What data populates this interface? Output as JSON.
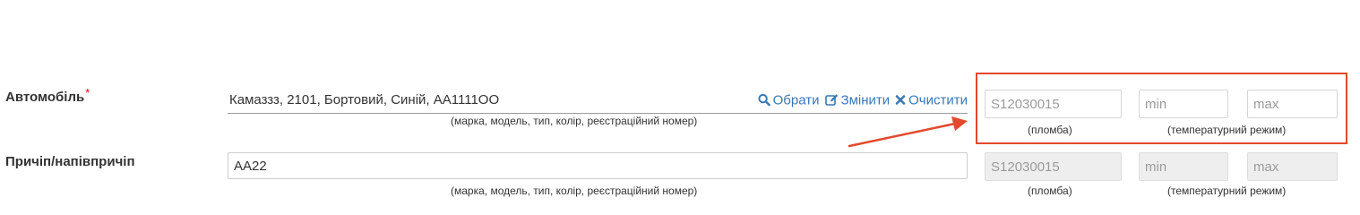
{
  "rows": [
    {
      "label": "Автомобіль",
      "required_mark": "*",
      "vehicle_value": "Камаззз, 2101, Бортовий, Синій, АА1111ОО",
      "vehicle_hint": "(марка, модель, тип, колір, реєстраційний номер)",
      "seal_placeholder": "S12030015",
      "seal_hint": "(пломба)",
      "temp_min_placeholder": "min",
      "temp_max_placeholder": "max",
      "temp_hint": "(температурний режим)"
    },
    {
      "label": "Причіп/напівпричіп",
      "vehicle_value": "АА22",
      "vehicle_hint": "(марка, модель, тип, колір, реєстраційний номер)",
      "seal_placeholder": "S12030015",
      "seal_hint": "(пломба)",
      "temp_min_placeholder": "min",
      "temp_max_placeholder": "max",
      "temp_hint": "(температурний режим)"
    }
  ],
  "actions": {
    "select_label": "Обрати",
    "edit_label": "Змінити",
    "clear_label": "Очистити"
  },
  "icons": {
    "select": "search-icon",
    "edit": "edit-icon",
    "clear": "close-icon"
  },
  "colors": {
    "link": "#3a78b5",
    "required": "#d0021b",
    "annotation": "#e2492f",
    "disabled_bg": "#eeeeee"
  }
}
